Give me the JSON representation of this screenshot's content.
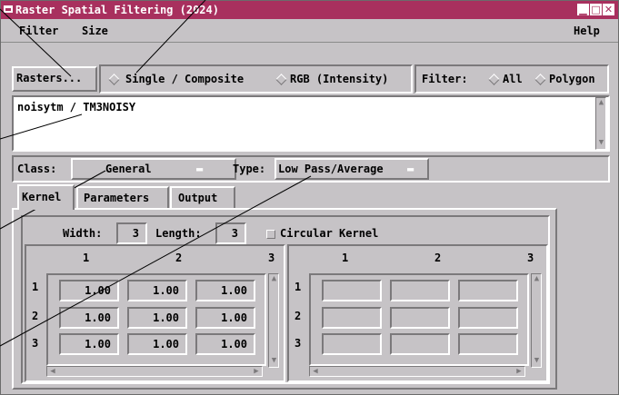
{
  "window": {
    "title": "Raster Spatial Filtering (2024)"
  },
  "menubar": {
    "filter": "Filter",
    "size": "Size",
    "help": "Help"
  },
  "toolbar": {
    "rasters_button": "Rasters...",
    "mode_single": "Single / Composite",
    "mode_rgb": "RGB (Intensity)",
    "filter_label": "Filter:",
    "filter_all": "All",
    "filter_polygon": "Polygon"
  },
  "raster_list": {
    "items": [
      "noisytm / TM3NOISY"
    ]
  },
  "class_row": {
    "class_label": "Class:",
    "class_value": "General",
    "type_label": "Type:",
    "type_value": "Low Pass/Average"
  },
  "tabs": [
    "Kernel",
    "Parameters",
    "Output"
  ],
  "kernel": {
    "width_label": "Width:",
    "width_value": "3",
    "length_label": "Length:",
    "length_value": "3",
    "circular_label": "Circular Kernel",
    "col_headers": [
      "1",
      "2",
      "3"
    ],
    "row_headers": [
      "1",
      "2",
      "3"
    ],
    "values": [
      [
        "1.00",
        "1.00",
        "1.00"
      ],
      [
        "1.00",
        "1.00",
        "1.00"
      ],
      [
        "1.00",
        "1.00",
        "1.00"
      ]
    ]
  }
}
